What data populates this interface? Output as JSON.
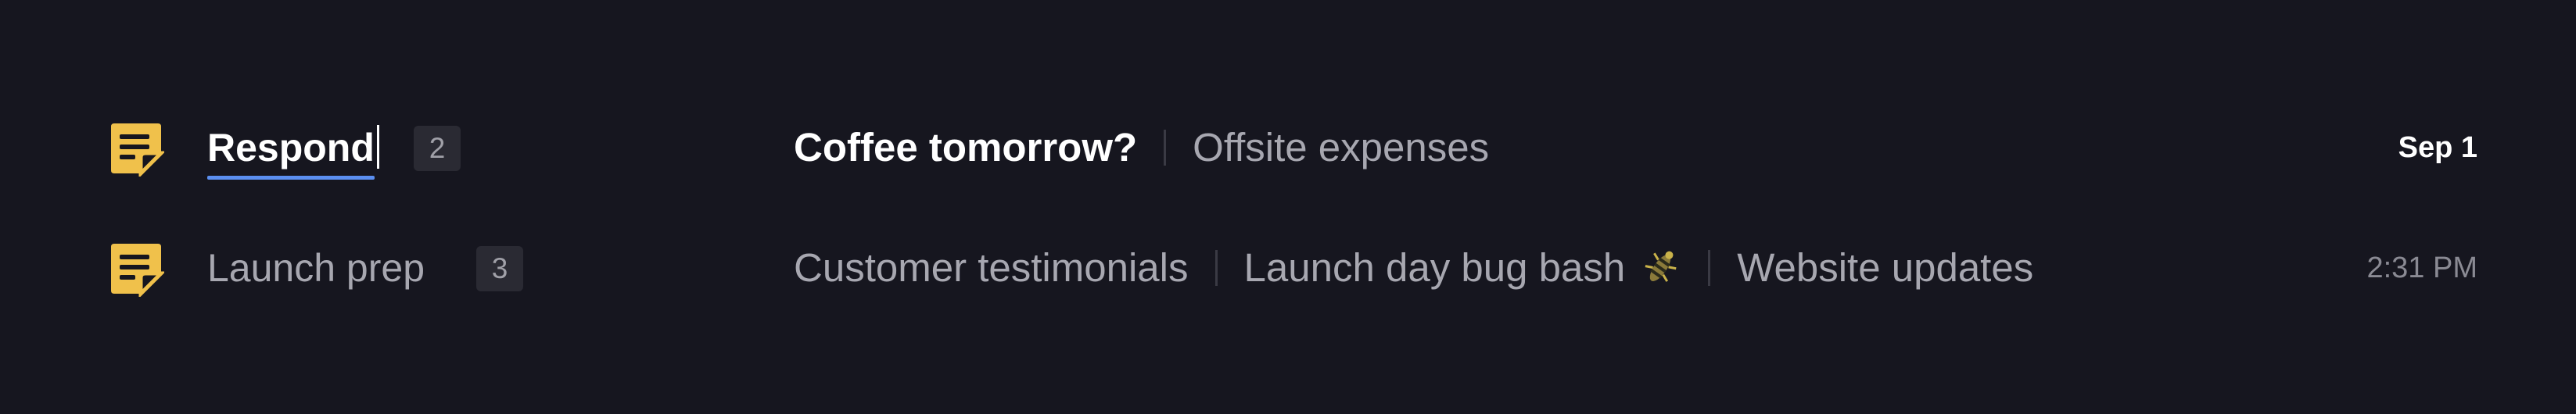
{
  "rows": [
    {
      "group": "Respond",
      "count": "2",
      "subjects": [
        "Coffee tomorrow?",
        "Offsite expenses"
      ],
      "date": "Sep 1",
      "unread": true
    },
    {
      "group": "Launch prep",
      "count": "3",
      "subjects": [
        "Customer testimonials",
        "Launch day bug bash",
        "Website updates"
      ],
      "date": "2:31 PM",
      "unread": false
    }
  ],
  "colors": {
    "background": "#16161f",
    "icon": "#f0c14b",
    "accent_underline": "#5b8ff0"
  },
  "icons": {
    "group_icon": "note-icon",
    "subject_icon": "bug-icon"
  }
}
